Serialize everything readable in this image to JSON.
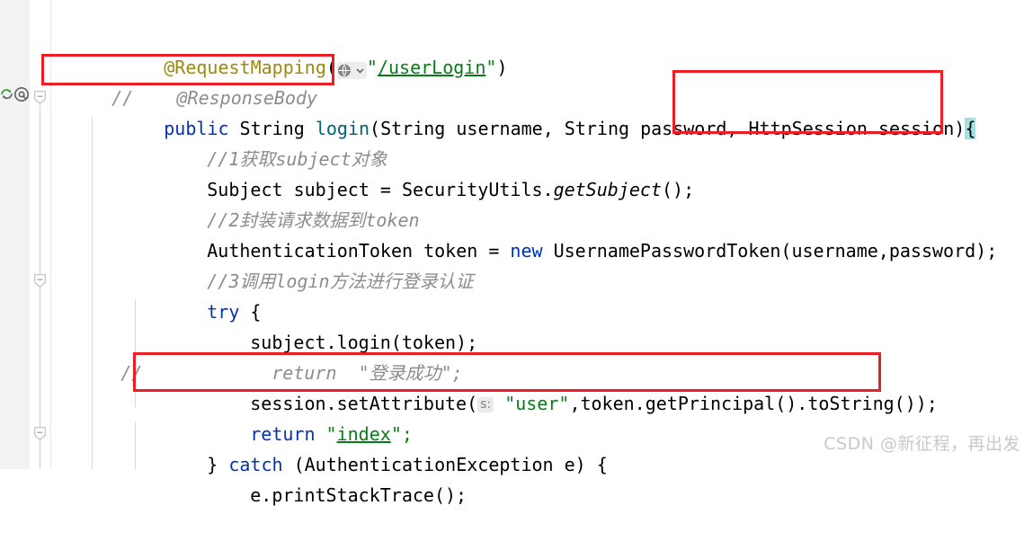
{
  "editor": {
    "language": "java",
    "font_size_px": 20,
    "background": "#ffffff",
    "gutter_background": "#f2f2f2"
  },
  "gutter": {
    "icons": [
      {
        "name": "override-method-icon",
        "glyph": "↻",
        "title": "override"
      },
      {
        "name": "annotation-icon",
        "glyph": "@",
        "title": "@"
      }
    ],
    "change_marker_color": "#4a9396",
    "fold_markers": [
      {
        "name": "fold-marker-method",
        "line": 3
      },
      {
        "name": "fold-marker-try",
        "line": 9
      },
      {
        "name": "fold-marker-catch",
        "line": 14
      }
    ]
  },
  "code": {
    "lines": [
      {
        "id": "line-request-mapping",
        "indent": 2,
        "tokens": [
          {
            "t": "@RequestMapping",
            "c": "anno"
          },
          {
            "t": "(",
            "c": "plain"
          },
          {
            "t": "",
            "c": "globe-chip"
          },
          {
            "t": "\"",
            "c": "str"
          },
          {
            "t": "/userLogin",
            "c": "strlink"
          },
          {
            "t": "\"",
            "c": "str"
          },
          {
            "t": ")",
            "c": "plain"
          }
        ],
        "text": "@RequestMapping(\"/userLogin\")"
      },
      {
        "id": "line-response-body-commented",
        "indent": 0,
        "tokens": [
          {
            "t": "//    @ResponseBody",
            "c": "cmt"
          }
        ],
        "text": "//    @ResponseBody"
      },
      {
        "id": "line-method-signature",
        "indent": 2,
        "tokens": [
          {
            "t": "public",
            "c": "kw"
          },
          {
            "t": " String ",
            "c": "plain"
          },
          {
            "t": "login",
            "c": "method"
          },
          {
            "t": "(String username, String password, HttpSession session)",
            "c": "plain"
          },
          {
            "t": "{",
            "c": "brace-hl"
          }
        ],
        "text": "public String login(String username, String password, HttpSession session){"
      },
      {
        "id": "line-comment-1",
        "indent": 4,
        "tokens": [
          {
            "t": "//1获取subject对象",
            "c": "cmt"
          }
        ],
        "text": "//1获取subject对象"
      },
      {
        "id": "line-get-subject",
        "indent": 4,
        "tokens": [
          {
            "t": "Subject subject = SecurityUtils.",
            "c": "plain"
          },
          {
            "t": "getSubject",
            "c": "static"
          },
          {
            "t": "();",
            "c": "plain"
          }
        ],
        "text": "Subject subject = SecurityUtils.getSubject();"
      },
      {
        "id": "line-comment-2",
        "indent": 4,
        "tokens": [
          {
            "t": "//2封装请求数据到token",
            "c": "cmt"
          }
        ],
        "text": "//2封装请求数据到token"
      },
      {
        "id": "line-new-token",
        "indent": 4,
        "tokens": [
          {
            "t": "AuthenticationToken token = ",
            "c": "plain"
          },
          {
            "t": "new",
            "c": "kw"
          },
          {
            "t": " UsernamePasswordToken(username,password);",
            "c": "plain"
          }
        ],
        "text": "AuthenticationToken token = new UsernamePasswordToken(username,password);"
      },
      {
        "id": "line-comment-3",
        "indent": 4,
        "tokens": [
          {
            "t": "//3调用login方法进行登录认证",
            "c": "cmt"
          }
        ],
        "text": "//3调用login方法进行登录认证"
      },
      {
        "id": "line-try",
        "indent": 4,
        "tokens": [
          {
            "t": "try",
            "c": "kw"
          },
          {
            "t": " {",
            "c": "plain"
          }
        ],
        "text": "try {"
      },
      {
        "id": "line-subject-login",
        "indent": 6,
        "tokens": [
          {
            "t": "subject.login(token);",
            "c": "plain"
          }
        ],
        "text": "subject.login(token);"
      },
      {
        "id": "line-return-success-commented",
        "indent": 7,
        "tokens": [
          {
            "t": "return  \"登录成功\";",
            "c": "cmt"
          }
        ],
        "text": "return  \"登录成功\";",
        "gutter_comment": "//"
      },
      {
        "id": "line-session-set-attribute",
        "indent": 6,
        "tokens": [
          {
            "t": "session.setAttribute(",
            "c": "plain"
          },
          {
            "t": "s:",
            "c": "inlay"
          },
          {
            "t": " ",
            "c": "plain"
          },
          {
            "t": "\"user\"",
            "c": "str"
          },
          {
            "t": ",token.getPrincipal().toString());",
            "c": "plain"
          }
        ],
        "text": "session.setAttribute( s: \"user\",token.getPrincipal().toString());"
      },
      {
        "id": "line-return-index",
        "indent": 6,
        "tokens": [
          {
            "t": "return",
            "c": "kw"
          },
          {
            "t": " ",
            "c": "plain"
          },
          {
            "t": "\"",
            "c": "str"
          },
          {
            "t": "index",
            "c": "strlink"
          },
          {
            "t": "\";",
            "c": "str"
          }
        ],
        "text": "return \"index\";"
      },
      {
        "id": "line-catch",
        "indent": 4,
        "tokens": [
          {
            "t": "} ",
            "c": "plain"
          },
          {
            "t": "catch",
            "c": "kw"
          },
          {
            "t": " (AuthenticationException e) {",
            "c": "plain"
          }
        ],
        "text": "} catch (AuthenticationException e) {"
      },
      {
        "id": "line-print-stack-trace",
        "indent": 6,
        "tokens": [
          {
            "t": "e.printStackTrace();",
            "c": "plain"
          }
        ],
        "text": "e.printStackTrace();"
      }
    ],
    "gutter_comment_marker": "//"
  },
  "annotations": {
    "highlight_color": "#ee1c25",
    "boxes": [
      {
        "name": "highlight-box-response-body",
        "label": "//    @ResponseBody"
      },
      {
        "name": "highlight-box-http-session",
        "label": "HttpSession session){"
      },
      {
        "name": "highlight-box-session-set-attribute",
        "label": "session.setAttribute( s: \"user\",token.getPrincipal().toString());"
      }
    ]
  },
  "watermark": {
    "text": "CSDN @新征程，再出发"
  }
}
